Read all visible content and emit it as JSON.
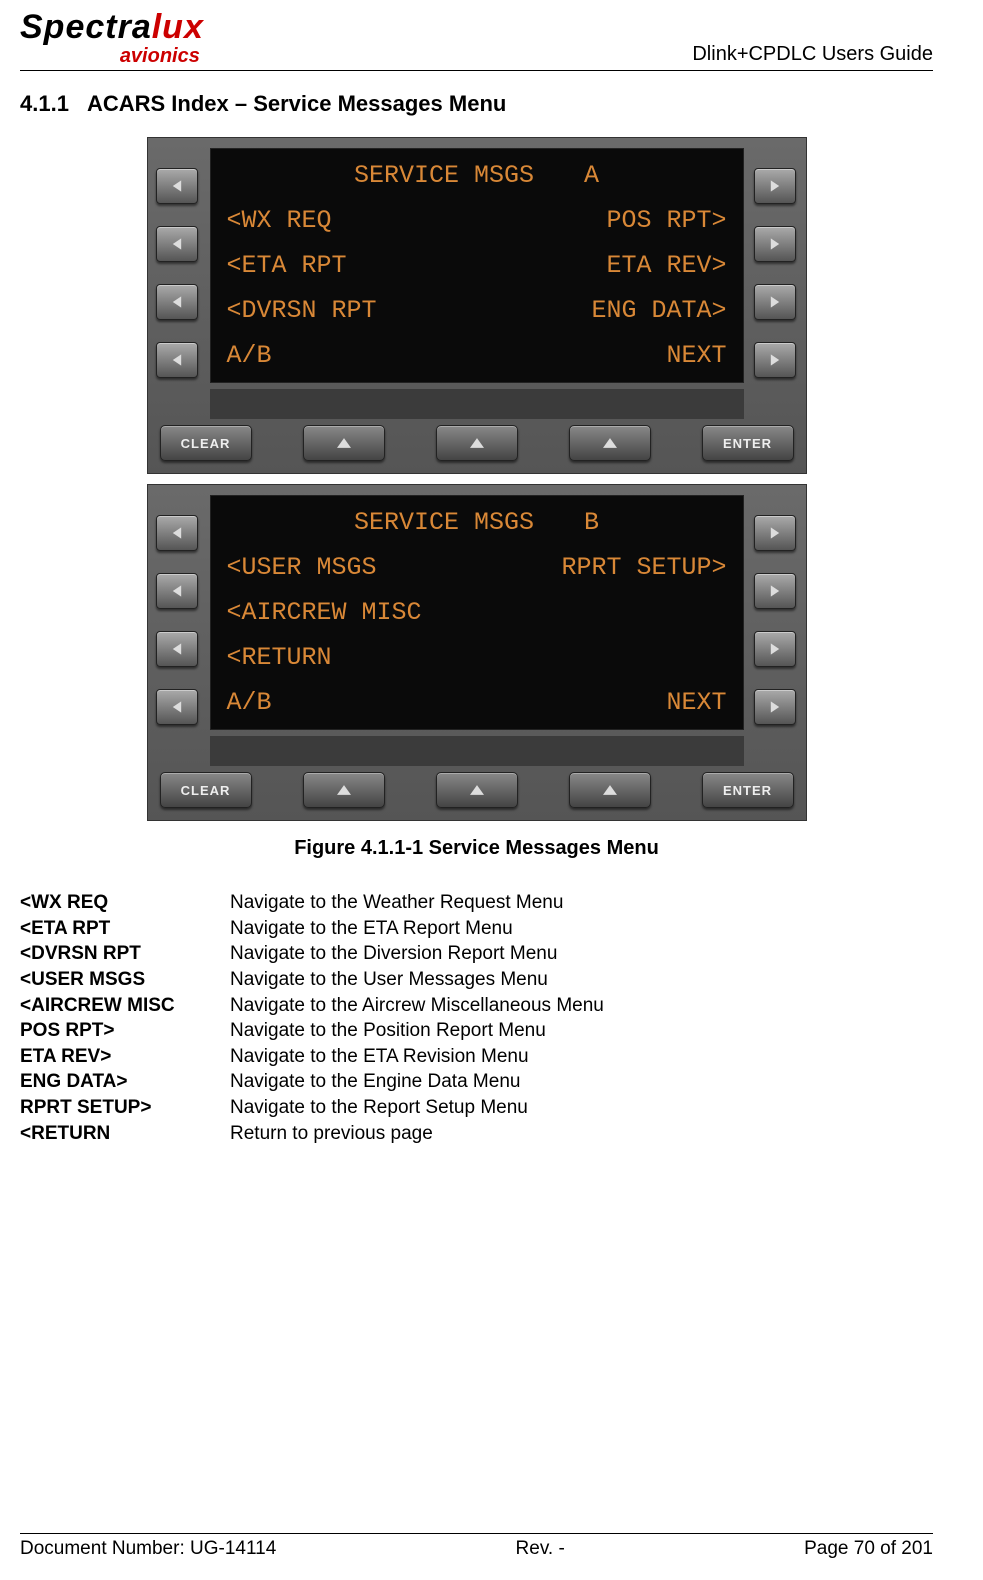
{
  "header": {
    "logo_main_a": "Spectra",
    "logo_main_b": "lux",
    "logo_sub": "avionics",
    "guide": "Dlink+CPDLC Users Guide"
  },
  "section": {
    "num": "4.1.1",
    "title": "ACARS Index – Service Messages Menu"
  },
  "screens": [
    {
      "title": "SERVICE MSGS",
      "page": "A",
      "rows": [
        {
          "left": "<WX REQ",
          "right": "POS RPT>"
        },
        {
          "left": "<ETA RPT",
          "right": "ETA REV>"
        },
        {
          "left": "<DVRSN RPT",
          "right": "ENG DATA>"
        },
        {
          "left": "A/B",
          "right": "NEXT"
        }
      ]
    },
    {
      "title": "SERVICE MSGS",
      "page": "B",
      "rows": [
        {
          "left": "<USER MSGS",
          "right": "RPRT SETUP>"
        },
        {
          "left": "<AIRCREW MISC",
          "right": ""
        },
        {
          "left": "<RETURN",
          "right": ""
        },
        {
          "left": "A/B",
          "right": "NEXT"
        }
      ]
    }
  ],
  "buttons": {
    "clear": "CLEAR",
    "enter": "ENTER"
  },
  "figure_caption": "Figure 4.1.1-1 Service Messages Menu",
  "descriptions": [
    {
      "key": "<WX REQ",
      "val": "Navigate to the Weather Request Menu"
    },
    {
      "key": "<ETA RPT",
      "val": "Navigate to the ETA Report Menu"
    },
    {
      "key": "<DVRSN RPT",
      "val": "Navigate to the Diversion Report Menu"
    },
    {
      "key": "<USER MSGS",
      "val": "Navigate to the User Messages Menu"
    },
    {
      "key": "<AIRCREW MISC",
      "val": "Navigate to the Aircrew Miscellaneous Menu"
    },
    {
      "key": "POS RPT>",
      "val": "Navigate to the Position Report Menu"
    },
    {
      "key": "ETA REV>",
      "val": "Navigate to the ETA Revision Menu"
    },
    {
      "key": "ENG DATA>",
      "val": "Navigate to the Engine Data Menu"
    },
    {
      "key": "RPRT SETUP>",
      "val": "Navigate to the Report Setup Menu"
    },
    {
      "key": "<RETURN",
      "val": "Return to previous page"
    }
  ],
  "footer": {
    "doc": "Document Number:  UG-14114",
    "rev": "Rev. -",
    "page": "Page 70 of 201"
  }
}
